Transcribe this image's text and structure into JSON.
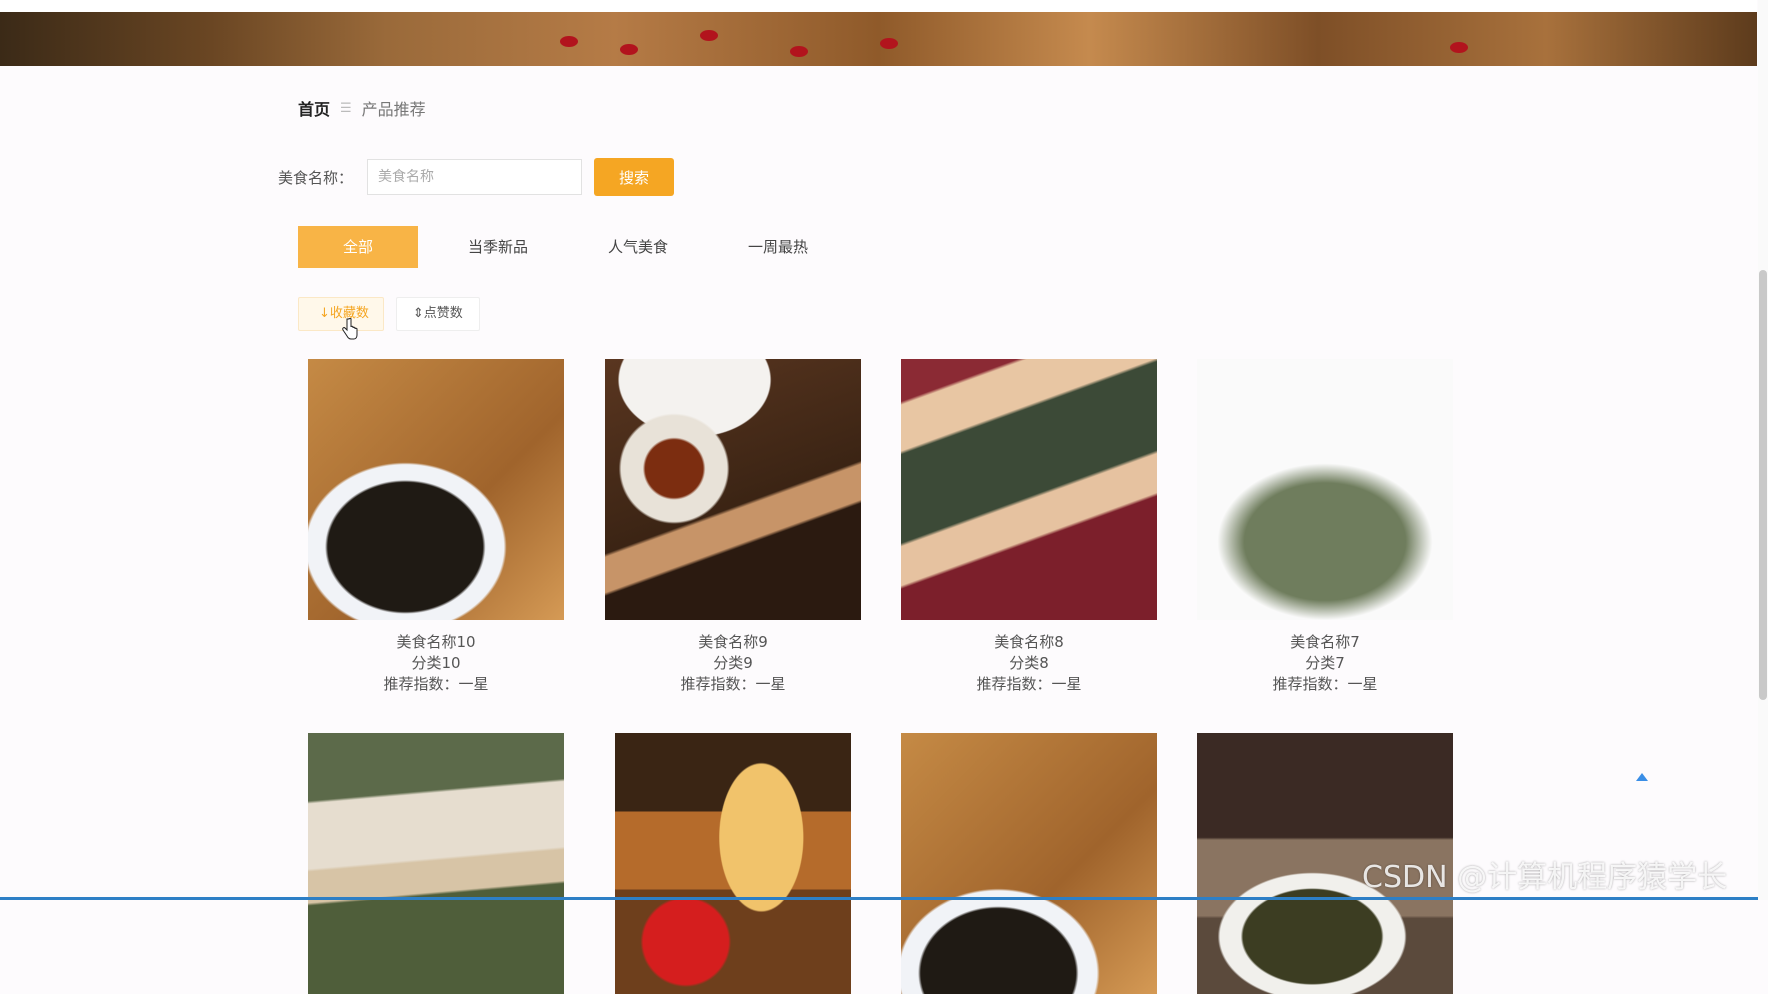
{
  "breadcrumb": {
    "home": "首页",
    "separator": "☰",
    "current": "产品推荐"
  },
  "search": {
    "label": "美食名称：",
    "placeholder": "美食名称",
    "button": "搜索"
  },
  "tabs": [
    "全部",
    "当季新品",
    "人气美食",
    "一周最热"
  ],
  "sort": {
    "favorites": "↓收藏数",
    "likes": "⇕点赞数"
  },
  "products": [
    {
      "name": "美食名称10",
      "category": "分类10",
      "recommend": "推荐指数：一星"
    },
    {
      "name": "美食名称9",
      "category": "分类9",
      "recommend": "推荐指数：一星"
    },
    {
      "name": "美食名称8",
      "category": "分类8",
      "recommend": "推荐指数：一星"
    },
    {
      "name": "美食名称7",
      "category": "分类7",
      "recommend": "推荐指数：一星"
    }
  ],
  "watermark": "CSDN @计算机程序猿学长",
  "colors": {
    "accent": "#f5a623",
    "tab_active": "#f8b446",
    "link_blue": "#3a8ee6"
  }
}
